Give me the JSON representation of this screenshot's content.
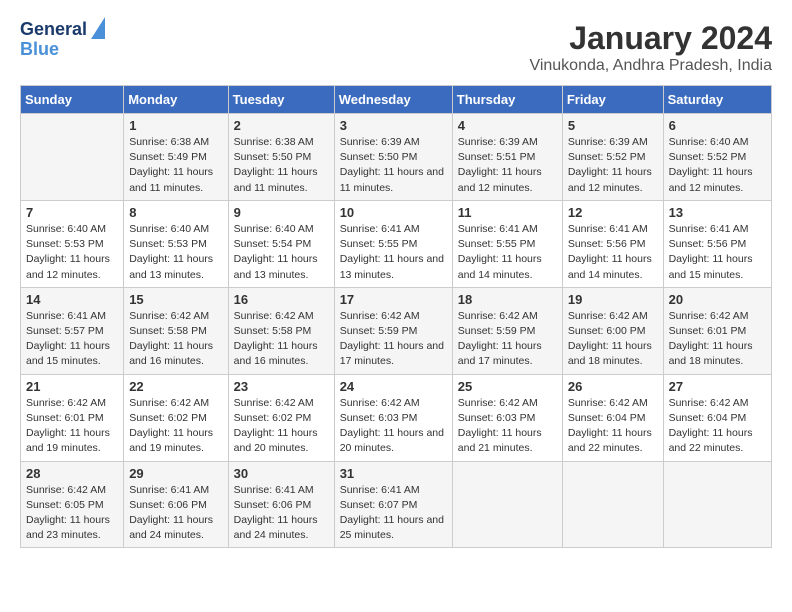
{
  "logo": {
    "line1": "General",
    "line2": "Blue"
  },
  "title": "January 2024",
  "subtitle": "Vinukonda, Andhra Pradesh, India",
  "weekdays": [
    "Sunday",
    "Monday",
    "Tuesday",
    "Wednesday",
    "Thursday",
    "Friday",
    "Saturday"
  ],
  "weeks": [
    [
      {
        "day": "",
        "info": ""
      },
      {
        "day": "1",
        "info": "Sunrise: 6:38 AM\nSunset: 5:49 PM\nDaylight: 11 hours and 11 minutes."
      },
      {
        "day": "2",
        "info": "Sunrise: 6:38 AM\nSunset: 5:50 PM\nDaylight: 11 hours and 11 minutes."
      },
      {
        "day": "3",
        "info": "Sunrise: 6:39 AM\nSunset: 5:50 PM\nDaylight: 11 hours and 11 minutes."
      },
      {
        "day": "4",
        "info": "Sunrise: 6:39 AM\nSunset: 5:51 PM\nDaylight: 11 hours and 12 minutes."
      },
      {
        "day": "5",
        "info": "Sunrise: 6:39 AM\nSunset: 5:52 PM\nDaylight: 11 hours and 12 minutes."
      },
      {
        "day": "6",
        "info": "Sunrise: 6:40 AM\nSunset: 5:52 PM\nDaylight: 11 hours and 12 minutes."
      }
    ],
    [
      {
        "day": "7",
        "info": "Sunrise: 6:40 AM\nSunset: 5:53 PM\nDaylight: 11 hours and 12 minutes."
      },
      {
        "day": "8",
        "info": "Sunrise: 6:40 AM\nSunset: 5:53 PM\nDaylight: 11 hours and 13 minutes."
      },
      {
        "day": "9",
        "info": "Sunrise: 6:40 AM\nSunset: 5:54 PM\nDaylight: 11 hours and 13 minutes."
      },
      {
        "day": "10",
        "info": "Sunrise: 6:41 AM\nSunset: 5:55 PM\nDaylight: 11 hours and 13 minutes."
      },
      {
        "day": "11",
        "info": "Sunrise: 6:41 AM\nSunset: 5:55 PM\nDaylight: 11 hours and 14 minutes."
      },
      {
        "day": "12",
        "info": "Sunrise: 6:41 AM\nSunset: 5:56 PM\nDaylight: 11 hours and 14 minutes."
      },
      {
        "day": "13",
        "info": "Sunrise: 6:41 AM\nSunset: 5:56 PM\nDaylight: 11 hours and 15 minutes."
      }
    ],
    [
      {
        "day": "14",
        "info": "Sunrise: 6:41 AM\nSunset: 5:57 PM\nDaylight: 11 hours and 15 minutes."
      },
      {
        "day": "15",
        "info": "Sunrise: 6:42 AM\nSunset: 5:58 PM\nDaylight: 11 hours and 16 minutes."
      },
      {
        "day": "16",
        "info": "Sunrise: 6:42 AM\nSunset: 5:58 PM\nDaylight: 11 hours and 16 minutes."
      },
      {
        "day": "17",
        "info": "Sunrise: 6:42 AM\nSunset: 5:59 PM\nDaylight: 11 hours and 17 minutes."
      },
      {
        "day": "18",
        "info": "Sunrise: 6:42 AM\nSunset: 5:59 PM\nDaylight: 11 hours and 17 minutes."
      },
      {
        "day": "19",
        "info": "Sunrise: 6:42 AM\nSunset: 6:00 PM\nDaylight: 11 hours and 18 minutes."
      },
      {
        "day": "20",
        "info": "Sunrise: 6:42 AM\nSunset: 6:01 PM\nDaylight: 11 hours and 18 minutes."
      }
    ],
    [
      {
        "day": "21",
        "info": "Sunrise: 6:42 AM\nSunset: 6:01 PM\nDaylight: 11 hours and 19 minutes."
      },
      {
        "day": "22",
        "info": "Sunrise: 6:42 AM\nSunset: 6:02 PM\nDaylight: 11 hours and 19 minutes."
      },
      {
        "day": "23",
        "info": "Sunrise: 6:42 AM\nSunset: 6:02 PM\nDaylight: 11 hours and 20 minutes."
      },
      {
        "day": "24",
        "info": "Sunrise: 6:42 AM\nSunset: 6:03 PM\nDaylight: 11 hours and 20 minutes."
      },
      {
        "day": "25",
        "info": "Sunrise: 6:42 AM\nSunset: 6:03 PM\nDaylight: 11 hours and 21 minutes."
      },
      {
        "day": "26",
        "info": "Sunrise: 6:42 AM\nSunset: 6:04 PM\nDaylight: 11 hours and 22 minutes."
      },
      {
        "day": "27",
        "info": "Sunrise: 6:42 AM\nSunset: 6:04 PM\nDaylight: 11 hours and 22 minutes."
      }
    ],
    [
      {
        "day": "28",
        "info": "Sunrise: 6:42 AM\nSunset: 6:05 PM\nDaylight: 11 hours and 23 minutes."
      },
      {
        "day": "29",
        "info": "Sunrise: 6:41 AM\nSunset: 6:06 PM\nDaylight: 11 hours and 24 minutes."
      },
      {
        "day": "30",
        "info": "Sunrise: 6:41 AM\nSunset: 6:06 PM\nDaylight: 11 hours and 24 minutes."
      },
      {
        "day": "31",
        "info": "Sunrise: 6:41 AM\nSunset: 6:07 PM\nDaylight: 11 hours and 25 minutes."
      },
      {
        "day": "",
        "info": ""
      },
      {
        "day": "",
        "info": ""
      },
      {
        "day": "",
        "info": ""
      }
    ]
  ]
}
